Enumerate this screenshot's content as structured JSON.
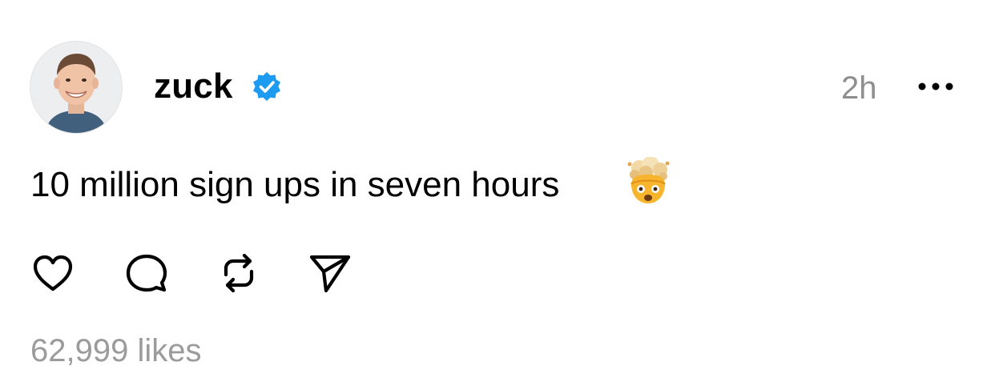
{
  "post": {
    "author": {
      "username": "zuck",
      "verified": true,
      "avatar_icon": "profile-photo"
    },
    "timestamp": "2h",
    "text": "10 million sign ups in seven hours",
    "emoji_icon": "exploding-head-emoji",
    "actions": [
      {
        "icon": "heart-icon"
      },
      {
        "icon": "comment-icon"
      },
      {
        "icon": "repost-icon"
      },
      {
        "icon": "share-icon"
      }
    ],
    "likes_text": "62,999 likes"
  },
  "colors": {
    "text": "#000000",
    "muted": "#8e8e8e",
    "verified_badge": "#1d9bf0",
    "background": "#ffffff"
  }
}
